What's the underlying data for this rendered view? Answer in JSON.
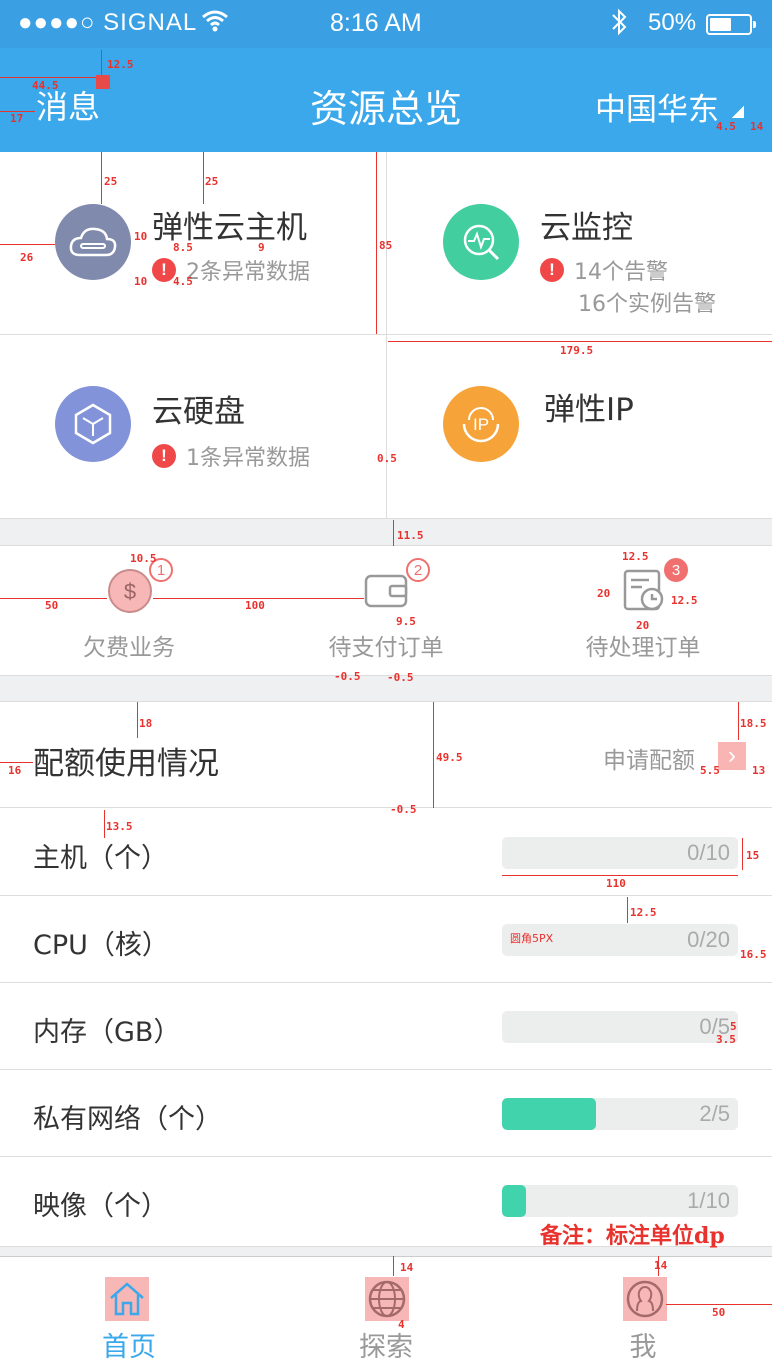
{
  "status_bar": {
    "signal": "●●●●○ SIGNAL",
    "time": "8:16 AM",
    "battery": "50%"
  },
  "nav": {
    "left": "消息",
    "title": "资源总览",
    "region": "中国华东"
  },
  "services": [
    {
      "title": "弹性云主机",
      "alert": "2条异常数据",
      "icon": "cloud-server-icon",
      "color": "#7f8aad"
    },
    {
      "title": "云监控",
      "alert": "14个告警",
      "sub": "16个实例告警",
      "icon": "monitor-icon",
      "color": "#42ce9f"
    },
    {
      "title": "云硬盘",
      "alert": "1条异常数据",
      "icon": "cube-icon",
      "color": "#8293d9"
    },
    {
      "title": "弹性IP",
      "icon": "ip-icon",
      "color": "#f6a43a"
    }
  ],
  "orders": [
    {
      "label": "欠费业务",
      "badge": "1",
      "icon": "dollar-icon"
    },
    {
      "label": "待支付订单",
      "badge": "2",
      "icon": "wallet-icon"
    },
    {
      "label": "待处理订单",
      "badge": "3",
      "icon": "clock-list-icon"
    }
  ],
  "quota": {
    "title": "配额使用情况",
    "apply": "申请配额",
    "rows": [
      {
        "label": "主机（个）",
        "value": "0/10",
        "fraction": 0
      },
      {
        "label": "CPU（核）",
        "value": "0/20",
        "fraction": 0
      },
      {
        "label": "内存（GB）",
        "value": "0/5",
        "fraction": 0
      },
      {
        "label": "私有网络（个）",
        "value": "2/5",
        "fraction": 0.4
      },
      {
        "label": "映像（个）",
        "value": "1/10",
        "fraction": 0.1
      }
    ]
  },
  "annotations": {
    "note": "备注：标注单位dp",
    "corner": "圆角5PX",
    "dims": [
      "12.5",
      "44.5",
      "17",
      "4.5",
      "14",
      "25",
      "25",
      "10",
      "8.5",
      "9",
      "26",
      "10",
      "4.5",
      "85",
      "179.5",
      "0.5",
      "11.5",
      "10.5",
      "50",
      "100",
      "12.5",
      "20",
      "12.5",
      "20",
      "9.5",
      "-0.5",
      "-0.5",
      "18",
      "49.5",
      "18.5",
      "16",
      "5.5",
      "13",
      "-0.5",
      "13.5",
      "15",
      "110",
      "12.5",
      "16.5",
      "5",
      "3.5",
      "14",
      "14",
      "4",
      "50"
    ]
  },
  "tabs": [
    {
      "label": "首页",
      "icon": "home-icon",
      "active": true
    },
    {
      "label": "探索",
      "icon": "globe-icon",
      "active": false
    },
    {
      "label": "我",
      "icon": "user-icon",
      "active": false
    }
  ],
  "colors": {
    "primary": "#3aa8ea",
    "alert": "#f04848",
    "progress": "#40d3ac",
    "annotation": "#e8322e"
  }
}
